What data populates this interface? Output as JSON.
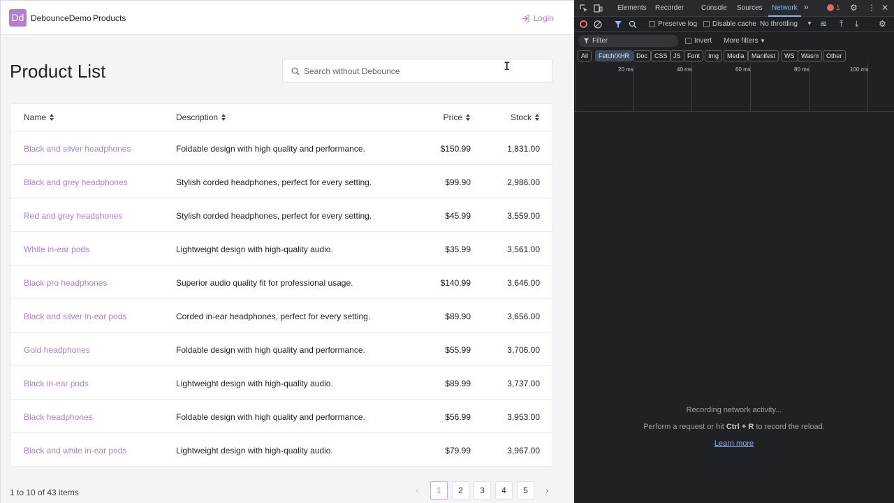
{
  "app": {
    "logo_text": "Dd",
    "brand": "DebounceDemo",
    "nav_products": "Products",
    "login": "Login",
    "page_title": "Product List",
    "search_placeholder": "Search without Debounce",
    "columns": {
      "name": "Name",
      "description": "Description",
      "price": "Price",
      "stock": "Stock"
    },
    "rows": [
      {
        "name": "Black and silver headphones",
        "description": "Foldable design with high quality and performance.",
        "price": "$150.99",
        "stock": "1,831.00"
      },
      {
        "name": "Black and grey headphones",
        "description": "Stylish corded headphones, perfect for every setting.",
        "price": "$99.90",
        "stock": "2,986.00"
      },
      {
        "name": "Red and grey headphones",
        "description": "Stylish corded headphones, perfect for every setting.",
        "price": "$45.99",
        "stock": "3,559.00"
      },
      {
        "name": "White in-ear pods",
        "description": "Lightweight design with high-quality audio.",
        "price": "$35.99",
        "stock": "3,561.00"
      },
      {
        "name": "Black pro headphones",
        "description": "Superior audio quality fit for professional usage.",
        "price": "$140.99",
        "stock": "3,646.00"
      },
      {
        "name": "Black and silver in-ear pods",
        "description": "Corded in-ear headphones, perfect for every setting.",
        "price": "$89.90",
        "stock": "3,656.00"
      },
      {
        "name": "Gold headphones",
        "description": "Foldable design with high quality and performance.",
        "price": "$55.99",
        "stock": "3,706.00"
      },
      {
        "name": "Black in-ear pods",
        "description": "Lightweight design with high-quality audio.",
        "price": "$89.99",
        "stock": "3,737.00"
      },
      {
        "name": "Black headphones",
        "description": "Foldable design with high quality and performance.",
        "price": "$56.99",
        "stock": "3,953.00"
      },
      {
        "name": "Black and white in-ear pods",
        "description": "Lightweight design with high-quality audio.",
        "price": "$79.99",
        "stock": "3,967.00"
      }
    ],
    "item_count": "1 to 10 of 43 items",
    "pages": [
      "1",
      "2",
      "3",
      "4",
      "5"
    ],
    "active_page": "1",
    "prev_glyph": "‹",
    "next_glyph": "›",
    "accent_color": "#b07fd0"
  },
  "devtools": {
    "tabs": [
      "Elements",
      "Recorder",
      "Console",
      "Sources",
      "Network"
    ],
    "active_tab": "Network",
    "error_count": "1",
    "preserve_log": "Preserve log",
    "disable_cache": "Disable cache",
    "throttling": "No throttling",
    "filter_placeholder": "Filter",
    "invert": "Invert",
    "more_filters": "More filters",
    "types": [
      "All",
      "Fetch/XHR",
      "Doc",
      "CSS",
      "JS",
      "Font",
      "Img",
      "Media",
      "Manifest",
      "WS",
      "Wasm",
      "Other"
    ],
    "selected_type": "Fetch/XHR",
    "timeline_labels": [
      "20 ms",
      "40 ms",
      "60 ms",
      "80 ms",
      "100 ms"
    ],
    "empty_title": "Recording network activity...",
    "empty_hint_prefix": "Perform a request or hit",
    "empty_hint_keys": "Ctrl + R",
    "empty_hint_suffix": "to record the reload.",
    "learn_more": "Learn more"
  }
}
